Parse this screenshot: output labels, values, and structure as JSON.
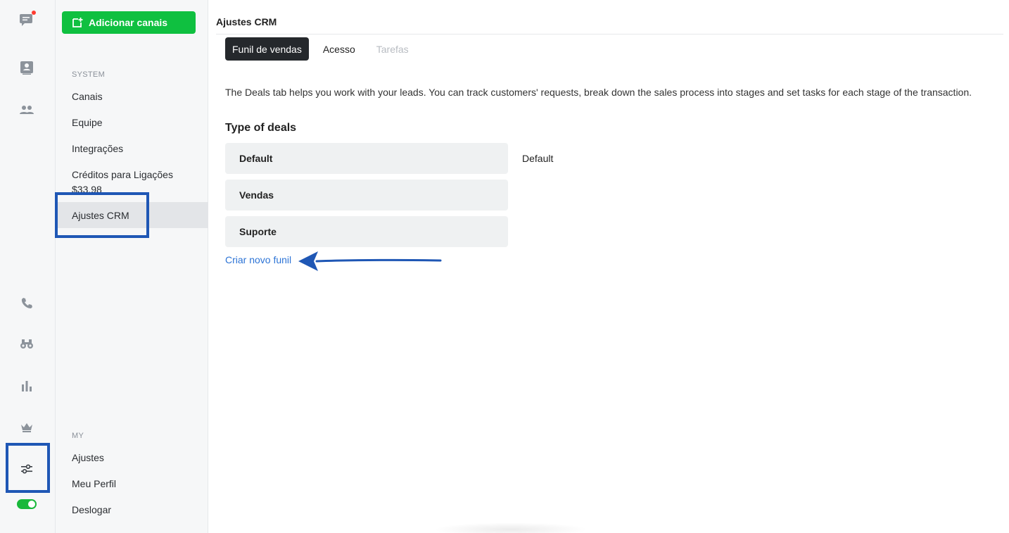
{
  "sidebar": {
    "add_button_label": "Adicionar canais",
    "system_label": "SYSTEM",
    "system_items": [
      "Canais",
      "Equipe",
      "Integrações",
      "Créditos para Ligações"
    ],
    "credits_balance": "$33.98",
    "active_item": "Ajustes CRM",
    "my_label": "MY",
    "my_items": [
      "Ajustes",
      "Meu Perfil",
      "Deslogar"
    ]
  },
  "rail": {
    "icons": [
      "chat-icon",
      "contact-card-icon",
      "team-icon",
      "phone-icon",
      "binoculars-icon",
      "bar-chart-icon",
      "crown-icon",
      "settings-sliders-icon"
    ],
    "status_toggle_on": true
  },
  "main": {
    "title": "Ajustes CRM",
    "tabs": [
      {
        "label": "Funil de vendas",
        "state": "active"
      },
      {
        "label": "Acesso",
        "state": "normal"
      },
      {
        "label": "Tarefas",
        "state": "disabled"
      }
    ],
    "description": "The Deals tab helps you work with your leads. You can track customers' requests, break down the sales process into stages and set tasks for each stage of the transaction.",
    "deals_heading": "Type of deals",
    "deals": [
      "Default",
      "Vendas",
      "Suporte"
    ],
    "default_tag": "Default",
    "create_link": "Criar novo funil"
  },
  "colors": {
    "accent_green": "#0fc040",
    "highlight_blue": "#1f57b5",
    "link_blue": "#2d74d6",
    "active_tab": "#25282c"
  }
}
